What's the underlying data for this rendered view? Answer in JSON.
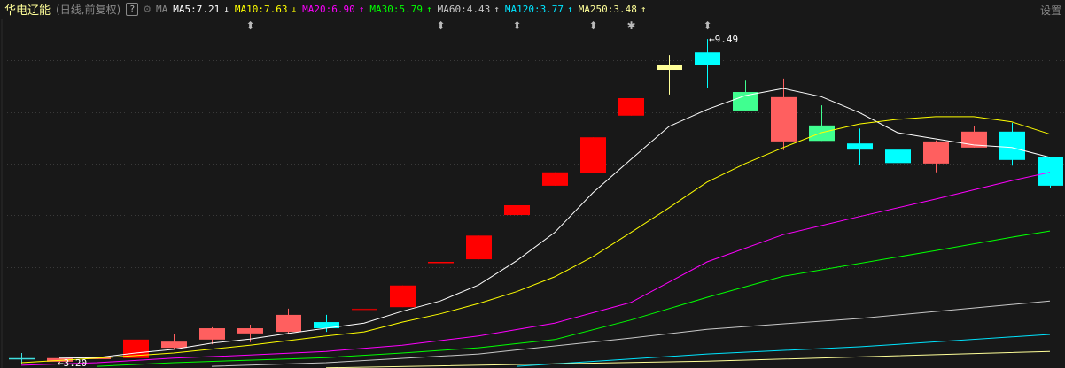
{
  "header": {
    "title": "华电辽能",
    "subtitle": "(日线,前复权)",
    "help_label": "?",
    "ma_label": "MA",
    "settings_label": "设置",
    "indicators": [
      {
        "label": "MA5:7.21",
        "color": "#ffffff",
        "arrow": "↓"
      },
      {
        "label": "MA10:7.63",
        "color": "#ffff00",
        "arrow": "↓"
      },
      {
        "label": "MA20:6.90",
        "color": "#ff00ff",
        "arrow": "↑"
      },
      {
        "label": "MA30:5.79",
        "color": "#00ff00",
        "arrow": "↑"
      },
      {
        "label": "MA60:4.43",
        "color": "#c8c8c8",
        "arrow": "↑"
      },
      {
        "label": "MA120:3.77",
        "color": "#00e5ff",
        "arrow": "↑"
      },
      {
        "label": "MA250:3.48",
        "color": "#ffff99",
        "arrow": "↑"
      }
    ]
  },
  "chart_data": {
    "type": "candlestick",
    "ylim": [
      3.097,
      9.87
    ],
    "grid_levels": [
      9.08,
      8.07,
      7.07,
      6.07,
      5.06,
      4.07
    ],
    "high_label": "9.49",
    "low_label": "3.20",
    "high_index": 18,
    "low_index": 1,
    "event_markers": [
      {
        "index": 6,
        "icon": "updown"
      },
      {
        "index": 11,
        "icon": "updown"
      },
      {
        "index": 13,
        "icon": "updown"
      },
      {
        "index": 15,
        "icon": "updown"
      },
      {
        "index": 16,
        "icon": "star"
      },
      {
        "index": 18,
        "icon": "updown"
      }
    ],
    "candles": [
      {
        "o": 3.29,
        "h": 3.39,
        "l": 3.18,
        "c": 3.29,
        "color": "#40e0e0"
      },
      {
        "o": 3.22,
        "h": 3.3,
        "l": 3.2,
        "c": 3.29,
        "color": "#ff5f5f"
      },
      {
        "o": 3.27,
        "h": 3.32,
        "l": 3.27,
        "c": 3.3,
        "color": "#ff5f5f"
      },
      {
        "o": 3.29,
        "h": 3.65,
        "l": 3.29,
        "c": 3.65,
        "color": "#ff0000"
      },
      {
        "o": 3.49,
        "h": 3.75,
        "l": 3.46,
        "c": 3.61,
        "color": "#ff5f5f"
      },
      {
        "o": 3.65,
        "h": 3.89,
        "l": 3.56,
        "c": 3.87,
        "color": "#ff5f5f"
      },
      {
        "o": 3.77,
        "h": 3.94,
        "l": 3.6,
        "c": 3.87,
        "color": "#ff5f5f"
      },
      {
        "o": 3.8,
        "h": 4.25,
        "l": 3.77,
        "c": 4.13,
        "color": "#ff5f5f"
      },
      {
        "o": 3.99,
        "h": 4.13,
        "l": 3.8,
        "c": 3.87,
        "color": "#00ffff"
      },
      {
        "o": 4.25,
        "h": 4.25,
        "l": 4.25,
        "c": 4.25,
        "color": "#cc0000"
      },
      {
        "o": 4.28,
        "h": 4.7,
        "l": 4.28,
        "c": 4.7,
        "color": "#ff0000"
      },
      {
        "o": 5.16,
        "h": 5.16,
        "l": 5.16,
        "c": 5.16,
        "color": "#ff0000"
      },
      {
        "o": 5.21,
        "h": 5.67,
        "l": 5.21,
        "c": 5.67,
        "color": "#ff0000"
      },
      {
        "o": 6.07,
        "h": 6.26,
        "l": 5.59,
        "c": 6.26,
        "color": "#ff0000"
      },
      {
        "o": 6.64,
        "h": 6.9,
        "l": 6.64,
        "c": 6.9,
        "color": "#ff0000"
      },
      {
        "o": 6.88,
        "h": 7.58,
        "l": 6.88,
        "c": 7.58,
        "color": "#ff0000"
      },
      {
        "o": 8.0,
        "h": 8.34,
        "l": 8.0,
        "c": 8.34,
        "color": "#ff0000"
      },
      {
        "o": 8.98,
        "h": 9.18,
        "l": 8.41,
        "c": 8.89,
        "color": "#ffff99"
      },
      {
        "o": 9.23,
        "h": 9.49,
        "l": 8.53,
        "c": 8.99,
        "color": "#00ffff"
      },
      {
        "o": 8.46,
        "h": 8.68,
        "l": 8.1,
        "c": 8.1,
        "color": "#40ff90"
      },
      {
        "o": 7.5,
        "h": 8.72,
        "l": 7.33,
        "c": 8.36,
        "color": "#ff5f5f"
      },
      {
        "o": 7.81,
        "h": 8.2,
        "l": 7.51,
        "c": 7.51,
        "color": "#40ff90"
      },
      {
        "o": 7.46,
        "h": 7.75,
        "l": 7.05,
        "c": 7.34,
        "color": "#00ffff"
      },
      {
        "o": 7.34,
        "h": 7.67,
        "l": 7.07,
        "c": 7.08,
        "color": "#00ffff"
      },
      {
        "o": 7.07,
        "h": 7.52,
        "l": 6.9,
        "c": 7.5,
        "color": "#ff5f5f"
      },
      {
        "o": 7.38,
        "h": 7.79,
        "l": 7.38,
        "c": 7.69,
        "color": "#ff5f5f"
      },
      {
        "o": 7.69,
        "h": 7.86,
        "l": 7.03,
        "c": 7.14,
        "color": "#00ffff"
      },
      {
        "o": 7.19,
        "h": 7.19,
        "l": 6.6,
        "c": 6.64,
        "color": "#00ffff"
      }
    ],
    "ma_series": [
      {
        "name": "MA5",
        "color": "#ffffff",
        "points": [
          [
            1,
            3.29
          ],
          [
            2,
            3.3
          ],
          [
            3,
            3.39
          ],
          [
            4,
            3.46
          ],
          [
            5,
            3.58
          ],
          [
            6,
            3.66
          ],
          [
            7,
            3.77
          ],
          [
            8,
            3.87
          ],
          [
            9,
            3.97
          ],
          [
            10,
            4.2
          ],
          [
            11,
            4.4
          ],
          [
            12,
            4.71
          ],
          [
            13,
            5.18
          ],
          [
            14,
            5.73
          ],
          [
            15,
            6.5
          ],
          [
            16,
            7.15
          ],
          [
            17,
            7.79
          ],
          [
            18,
            8.12
          ],
          [
            19,
            8.39
          ],
          [
            20,
            8.53
          ],
          [
            21,
            8.37
          ],
          [
            22,
            8.06
          ],
          [
            23,
            7.67
          ],
          [
            24,
            7.55
          ],
          [
            25,
            7.43
          ],
          [
            26,
            7.38
          ],
          [
            27,
            7.19
          ]
        ]
      },
      {
        "name": "MA10",
        "color": "#ffff00",
        "points": [
          [
            0,
            3.2
          ],
          [
            2,
            3.29
          ],
          [
            4,
            3.39
          ],
          [
            6,
            3.54
          ],
          [
            8,
            3.72
          ],
          [
            9,
            3.8
          ],
          [
            10,
            3.99
          ],
          [
            11,
            4.15
          ],
          [
            12,
            4.35
          ],
          [
            13,
            4.58
          ],
          [
            14,
            4.87
          ],
          [
            15,
            5.26
          ],
          [
            16,
            5.73
          ],
          [
            17,
            6.21
          ],
          [
            18,
            6.71
          ],
          [
            19,
            7.07
          ],
          [
            20,
            7.38
          ],
          [
            21,
            7.67
          ],
          [
            22,
            7.84
          ],
          [
            23,
            7.93
          ],
          [
            24,
            7.98
          ],
          [
            25,
            7.98
          ],
          [
            26,
            7.88
          ],
          [
            27,
            7.64
          ]
        ]
      },
      {
        "name": "MA20",
        "color": "#ff00ff",
        "points": [
          [
            0,
            3.15
          ],
          [
            2,
            3.2
          ],
          [
            4,
            3.29
          ],
          [
            6,
            3.35
          ],
          [
            8,
            3.42
          ],
          [
            10,
            3.54
          ],
          [
            12,
            3.72
          ],
          [
            14,
            3.97
          ],
          [
            16,
            4.37
          ],
          [
            18,
            5.16
          ],
          [
            20,
            5.69
          ],
          [
            22,
            6.04
          ],
          [
            24,
            6.38
          ],
          [
            26,
            6.74
          ],
          [
            27,
            6.9
          ]
        ]
      },
      {
        "name": "MA30",
        "color": "#00ff00",
        "points": [
          [
            2,
            3.13
          ],
          [
            4,
            3.2
          ],
          [
            6,
            3.25
          ],
          [
            8,
            3.3
          ],
          [
            10,
            3.39
          ],
          [
            12,
            3.49
          ],
          [
            14,
            3.65
          ],
          [
            16,
            4.03
          ],
          [
            18,
            4.47
          ],
          [
            20,
            4.88
          ],
          [
            22,
            5.13
          ],
          [
            24,
            5.38
          ],
          [
            26,
            5.64
          ],
          [
            27,
            5.76
          ]
        ]
      },
      {
        "name": "MA60",
        "color": "#c8c8c8",
        "points": [
          [
            5,
            3.13
          ],
          [
            8,
            3.2
          ],
          [
            12,
            3.37
          ],
          [
            16,
            3.68
          ],
          [
            18,
            3.85
          ],
          [
            22,
            4.06
          ],
          [
            27,
            4.4
          ]
        ]
      },
      {
        "name": "MA120",
        "color": "#00e5ff",
        "points": [
          [
            13,
            3.13
          ],
          [
            18,
            3.37
          ],
          [
            22,
            3.51
          ],
          [
            27,
            3.75
          ]
        ]
      },
      {
        "name": "MA250",
        "color": "#ffff99",
        "points": [
          [
            8,
            3.1
          ],
          [
            18,
            3.23
          ],
          [
            27,
            3.42
          ]
        ]
      }
    ]
  }
}
